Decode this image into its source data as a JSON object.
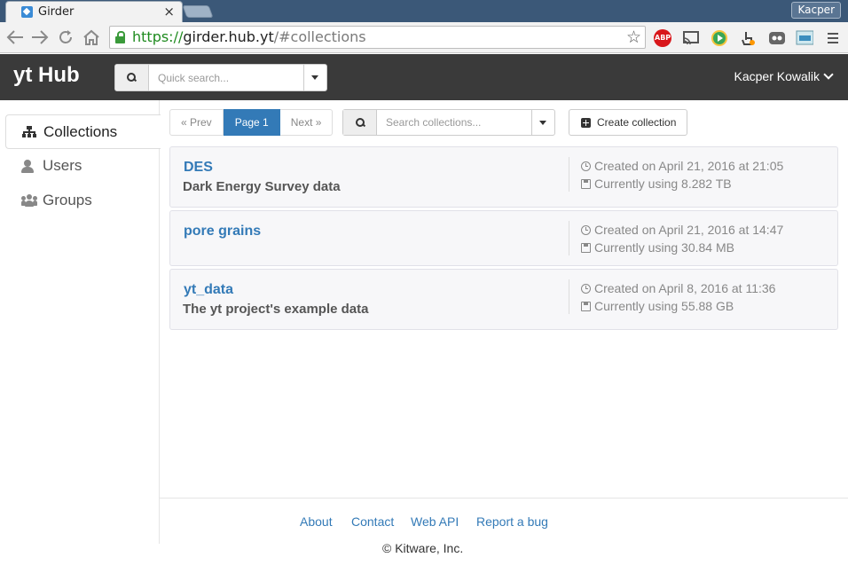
{
  "browser": {
    "tab_title": "Girder",
    "tab_close": "×",
    "profile_name": "Kacper",
    "url_scheme": "https://",
    "url_host": "girder.hub.yt",
    "url_path": "/#collections",
    "extensions": [
      "adblock-plus-icon",
      "cast-icon",
      "play-icon",
      "hand-pointer-icon",
      "ghostery-icon",
      "screenshot-icon",
      "menu-icon"
    ],
    "extension_abp_label": "ABP"
  },
  "header": {
    "brand": "yt Hub",
    "quick_search_placeholder": "Quick search...",
    "user_name": "Kacper Kowalik"
  },
  "sidebar": {
    "items": [
      {
        "label": "Collections",
        "icon": "sitemap-icon",
        "active": true
      },
      {
        "label": "Users",
        "icon": "user-icon",
        "active": false
      },
      {
        "label": "Groups",
        "icon": "group-icon",
        "active": false
      }
    ]
  },
  "pager": {
    "prev": "« Prev",
    "page": "Page 1",
    "next": "Next »"
  },
  "collection_search": {
    "placeholder": "Search collections..."
  },
  "create_button": "Create collection",
  "collections": [
    {
      "name": "DES",
      "description": "Dark Energy Survey data",
      "created": "Created on April 21, 2016 at 21:05",
      "size": "Currently using 8.282 TB"
    },
    {
      "name": "pore grains",
      "description": "",
      "created": "Created on April 21, 2016 at 14:47",
      "size": "Currently using 30.84 MB"
    },
    {
      "name": "yt_data",
      "description": "The yt project's example data",
      "created": "Created on April 8, 2016 at 11:36",
      "size": "Currently using 55.88 GB"
    }
  ],
  "footer": {
    "links": [
      "About",
      "Contact",
      "Web API",
      "Report a bug"
    ],
    "copyright": "© Kitware, Inc."
  },
  "colors": {
    "accent": "#337ab7",
    "header_bg": "#3a3a3a",
    "tabstrip_bg": "#3b5878"
  }
}
